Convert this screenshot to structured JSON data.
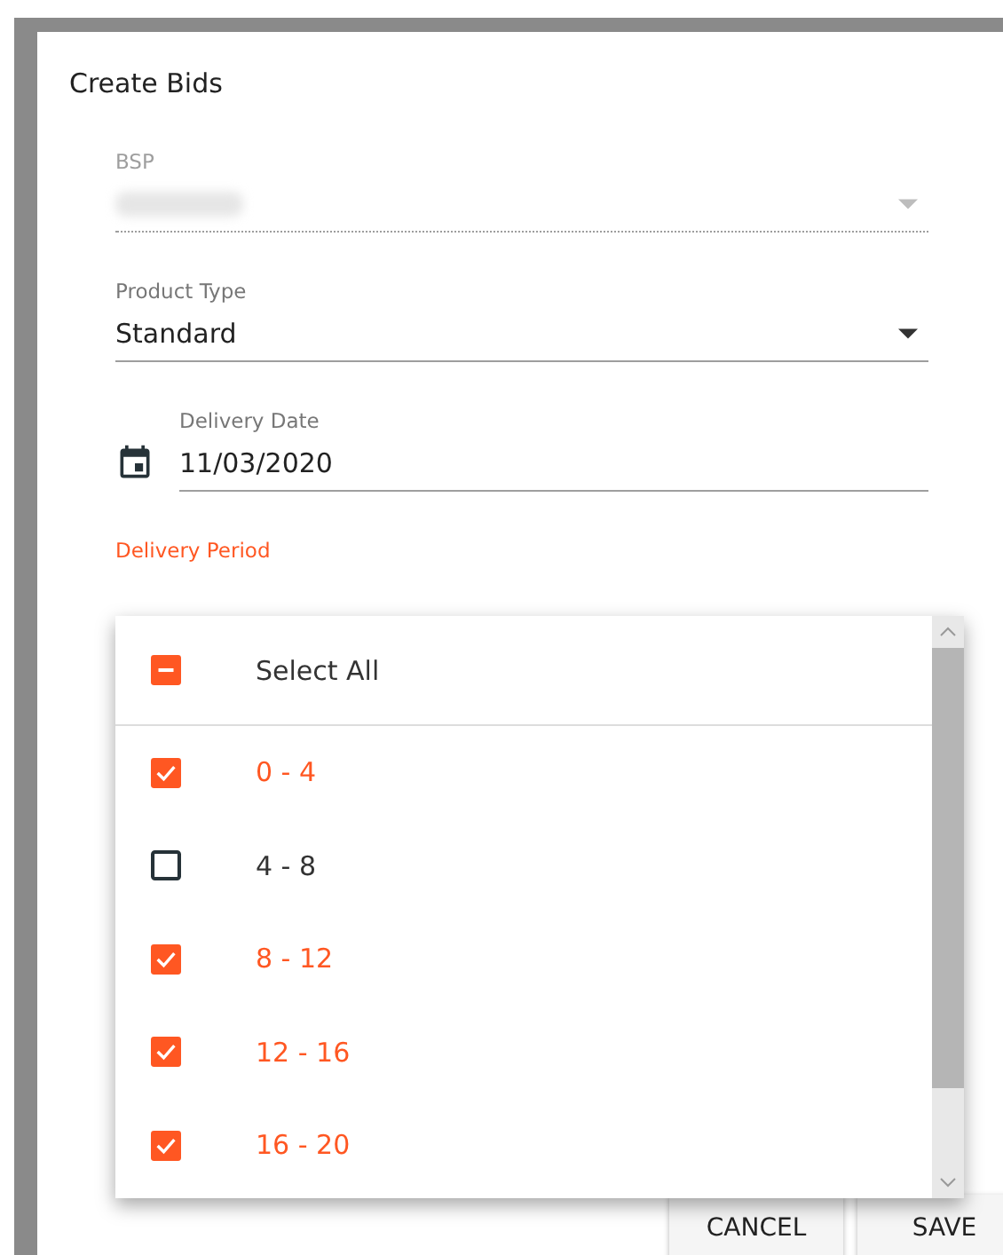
{
  "dialog": {
    "title": "Create Bids",
    "fields": [
      {
        "kind": "select",
        "label": "BSP",
        "disabled": true,
        "redacted": true
      },
      {
        "kind": "select",
        "label": "Product Type",
        "value": "Standard",
        "disabled": false
      },
      {
        "kind": "date",
        "label": "Delivery Date",
        "value": "11/03/2020"
      },
      {
        "kind": "multiselect",
        "label": "Delivery Period",
        "focused": true
      }
    ],
    "buttons": [
      "CANCEL",
      "SAVE"
    ]
  },
  "menu": {
    "select_all": {
      "label": "Select All",
      "checked": false,
      "indeterminate": true
    },
    "options": [
      {
        "label": "0 - 4",
        "checked": true
      },
      {
        "label": "4 - 8",
        "checked": false
      },
      {
        "label": "8 - 12",
        "checked": true
      },
      {
        "label": "12 - 16",
        "checked": true
      },
      {
        "label": "16 - 20",
        "checked": true
      }
    ]
  }
}
